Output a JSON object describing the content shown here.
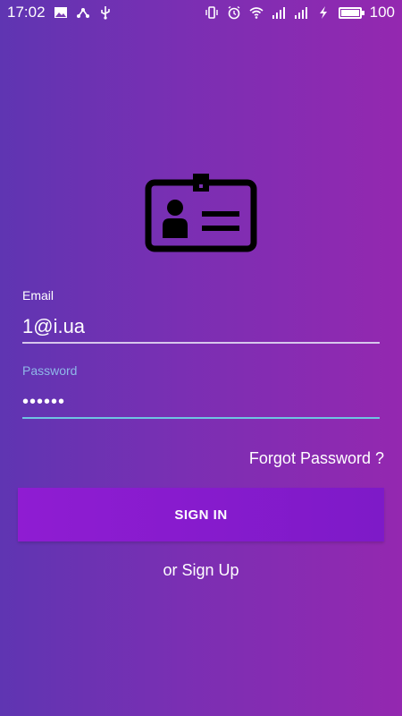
{
  "status_bar": {
    "time": "17:02",
    "battery_level": "100",
    "left_icons": [
      "image-icon",
      "usb-share-icon",
      "usb-icon"
    ],
    "right_icons": [
      "vibrate-icon",
      "alarm-icon",
      "wifi-icon",
      "signal-icon",
      "signal-icon",
      "charging-icon",
      "battery-icon"
    ]
  },
  "form": {
    "email_label": "Email",
    "email_value": "1@i.ua",
    "password_label": "Password",
    "password_value": "••••••",
    "forgot_password": "Forgot Password ?",
    "sign_in": "SIGN IN",
    "sign_up": "or Sign Up"
  },
  "colors": {
    "gradient_start": "#5f35b2",
    "gradient_end": "#9428b0",
    "button": "#8f1cd2",
    "password_label": "#8fb8e8",
    "password_underline": "#6fc3e2"
  },
  "icons": {
    "logo": "id-card-icon"
  }
}
